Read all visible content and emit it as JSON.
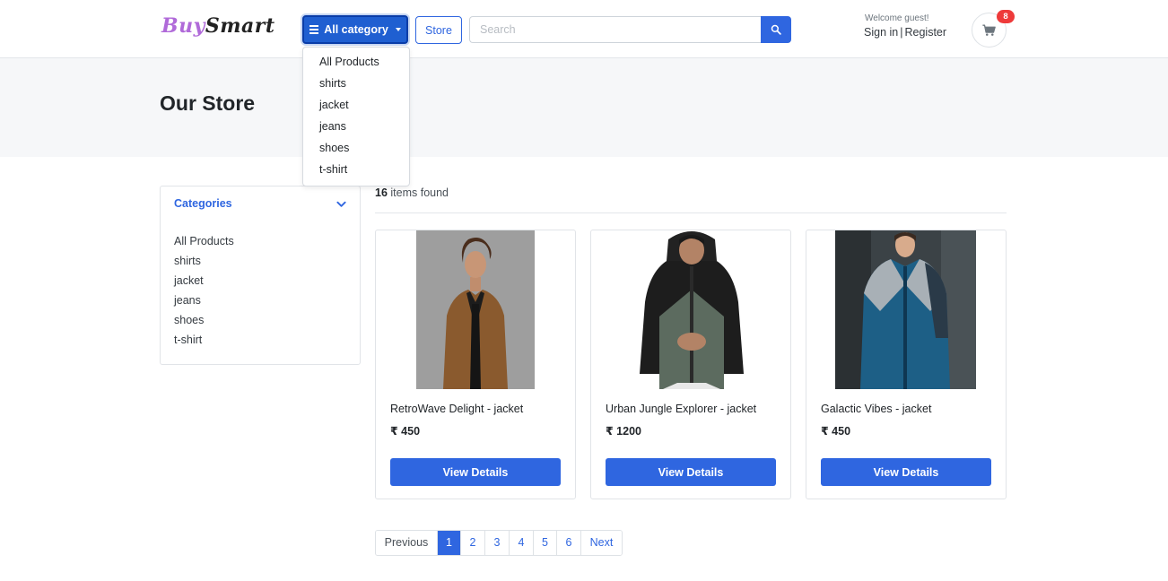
{
  "header": {
    "logo": {
      "part1": "Buy",
      "part2": "Smart"
    },
    "category_button": "All category",
    "store_button": "Store",
    "search_placeholder": "Search",
    "welcome": "Welcome guest!",
    "sign_in": "Sign in",
    "separator": "|",
    "register": "Register",
    "cart_count": "8",
    "icons": {
      "search": "search-icon",
      "cart": "cart-icon",
      "menu": "menu-icon",
      "caret": "caret-down-icon"
    },
    "colors": {
      "primary": "#2f66e0",
      "badge": "#ee3a3a",
      "logo_accent": "#b06ad9"
    }
  },
  "dropdown": {
    "items": [
      "All Products",
      "shirts",
      "jacket",
      "jeans",
      "shoes",
      "t-shirt"
    ]
  },
  "page": {
    "title": "Our Store"
  },
  "sidebar": {
    "title": "Categories",
    "items": [
      "All Products",
      "shirts",
      "jacket",
      "jeans",
      "shoes",
      "t-shirt"
    ]
  },
  "results": {
    "count": "16",
    "label": "items found"
  },
  "products": [
    {
      "name": "RetroWave Delight - jacket",
      "price": "₹ 450",
      "button": "View Details"
    },
    {
      "name": "Urban Jungle Explorer - jacket",
      "price": "₹ 1200",
      "button": "View Details"
    },
    {
      "name": "Galactic Vibes - jacket",
      "price": "₹ 450",
      "button": "View Details"
    }
  ],
  "pagination": {
    "previous": "Previous",
    "pages": [
      "1",
      "2",
      "3",
      "4",
      "5",
      "6"
    ],
    "active": "1",
    "next": "Next"
  }
}
